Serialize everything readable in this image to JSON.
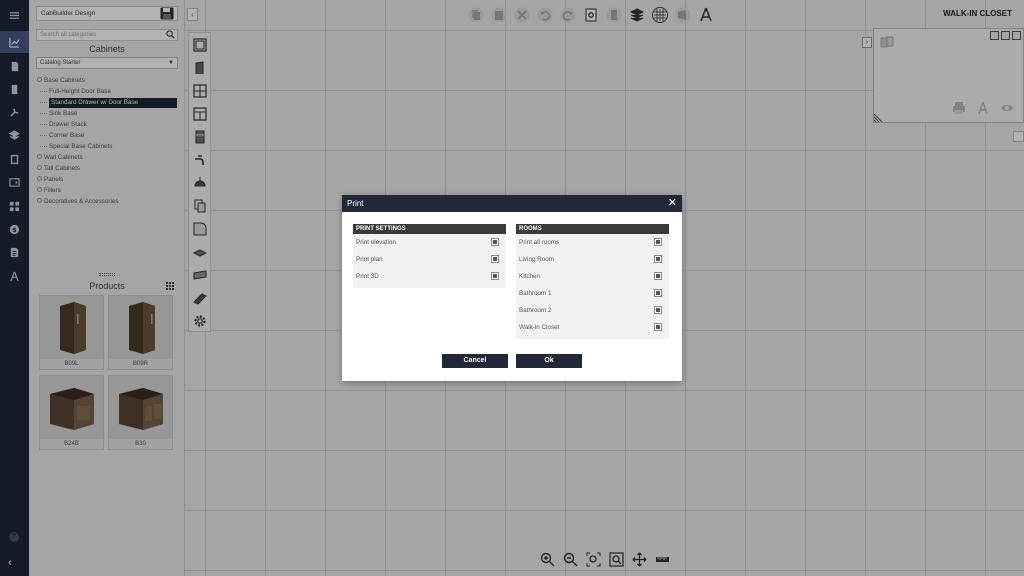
{
  "app": {
    "project_name": "CabBuilder Design",
    "room_name": "WALK-IN CLOSET"
  },
  "catalog": {
    "search_placeholder": "Search all categories",
    "section_title": "Cabinets",
    "catalog_select": "Catalog Starter",
    "tree": {
      "base": "Base Cabinets",
      "base_children": [
        "Full-Height Door Base",
        "Standard Drawer w/ Door Base",
        "Sink Base",
        "Drawer Stack",
        "Corner Base",
        "Special Base Cabinets"
      ],
      "others": [
        "Wall Cabinets",
        "Tall Cabinets",
        "Panels",
        "Fillers",
        "Decoratives & Accessories"
      ]
    },
    "products_title": "Products",
    "products": [
      {
        "code": "B09L"
      },
      {
        "code": "B09R"
      },
      {
        "code": "B24B"
      },
      {
        "code": "B30"
      }
    ]
  },
  "dialog": {
    "title": "Print",
    "print_settings_header": "PRINT SETTINGS",
    "print_settings": [
      "Print elevation",
      "Print plan",
      "Print 3D"
    ],
    "rooms_header": "ROOMS",
    "rooms": [
      "Print all rooms",
      "Living Room",
      "Kitchen",
      "Bathroom 1",
      "Bathroom 2",
      "Walk-in Closet"
    ],
    "cancel_label": "Cancel",
    "ok_label": "Ok"
  }
}
